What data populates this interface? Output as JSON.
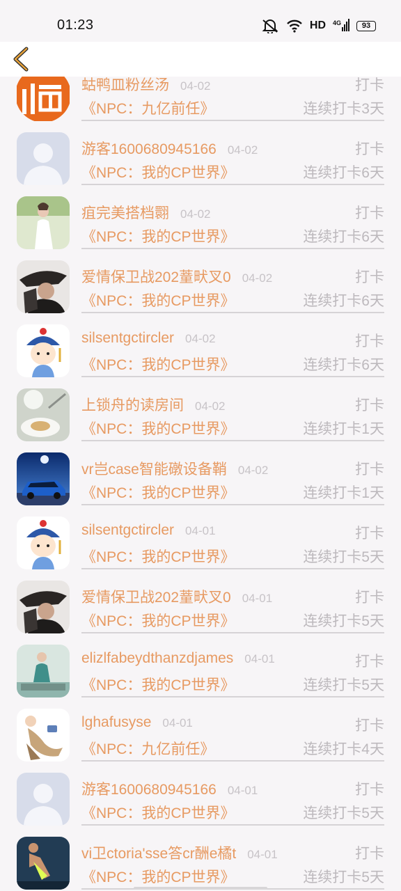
{
  "status": {
    "time": "01:23",
    "network": "HD",
    "signal_type": "4G",
    "battery": "93"
  },
  "nav": {
    "back_icon": "chevron-left-icon",
    "accent": "#e7a23a"
  },
  "colors": {
    "name": "#e79a62",
    "muted": "#bdb9bd",
    "date": "#c7c3c7"
  },
  "items": [
    {
      "name": "蛄鸭皿粉丝汤",
      "date": "04-02",
      "action": "打卡",
      "npc": "《NPC：九亿前任》",
      "streak": "连续打卡3天",
      "avatar": "fu-character"
    },
    {
      "name": "游客1600680945166",
      "date": "04-02",
      "action": "打卡",
      "npc": "《NPC：我的CP世界》",
      "streak": "连续打卡6天",
      "avatar": "default-silhouette"
    },
    {
      "name": "疽完美搭档翾",
      "date": "04-02",
      "action": "打卡",
      "npc": "《NPC：我的CP世界》",
      "streak": "连续打卡6天",
      "avatar": "woman-white-dress"
    },
    {
      "name": "爱情保卫战202蕫畎叉0",
      "date": "04-02",
      "action": "打卡",
      "npc": "《NPC：我的CP世界》",
      "streak": "连续打卡6天",
      "avatar": "man-hat-dark"
    },
    {
      "name": "silsentgctircler",
      "date": "04-02",
      "action": "打卡",
      "npc": "《NPC：我的CP世界》",
      "streak": "连续打卡6天",
      "avatar": "cartoon-qing-official"
    },
    {
      "name": "上锁舟的读房间",
      "date": "04-02",
      "action": "打卡",
      "npc": "《NPC：我的CP世界》",
      "streak": "连续打卡1天",
      "avatar": "food-plate"
    },
    {
      "name": "vr岂case智能礅设备鞘",
      "date": "04-02",
      "action": "打卡",
      "npc": "《NPC：我的CP世界》",
      "streak": "连续打卡1天",
      "avatar": "blue-sports-car"
    },
    {
      "name": "silsentgctircler",
      "date": "04-01",
      "action": "打卡",
      "npc": "《NPC：我的CP世界》",
      "streak": "连续打卡5天",
      "avatar": "cartoon-qing-official"
    },
    {
      "name": "爱情保卫战202蕫畎叉0",
      "date": "04-01",
      "action": "打卡",
      "npc": "《NPC：我的CP世界》",
      "streak": "连续打卡5天",
      "avatar": "man-hat-dark"
    },
    {
      "name": "elizlfabeydthanzdjames",
      "date": "04-01",
      "action": "打卡",
      "npc": "《NPC：我的CP世界》",
      "streak": "连续打卡5天",
      "avatar": "girl-teal"
    },
    {
      "name": "lghafusyse",
      "date": "04-01",
      "action": "打卡",
      "npc": "《NPC：九亿前任》",
      "streak": "连续打卡4天",
      "avatar": "cartoon-flying"
    },
    {
      "name": "游客1600680945166",
      "date": "04-01",
      "action": "打卡",
      "npc": "《NPC：我的CP世界》",
      "streak": "连续打卡5天",
      "avatar": "default-silhouette"
    },
    {
      "name": "vi卫ctoria'sse答cr酬e橘t",
      "date": "04-01",
      "action": "打卡",
      "npc": "《NPC：我的CP世界》",
      "streak": "连续打卡5天",
      "avatar": "fitness-woman"
    }
  ]
}
